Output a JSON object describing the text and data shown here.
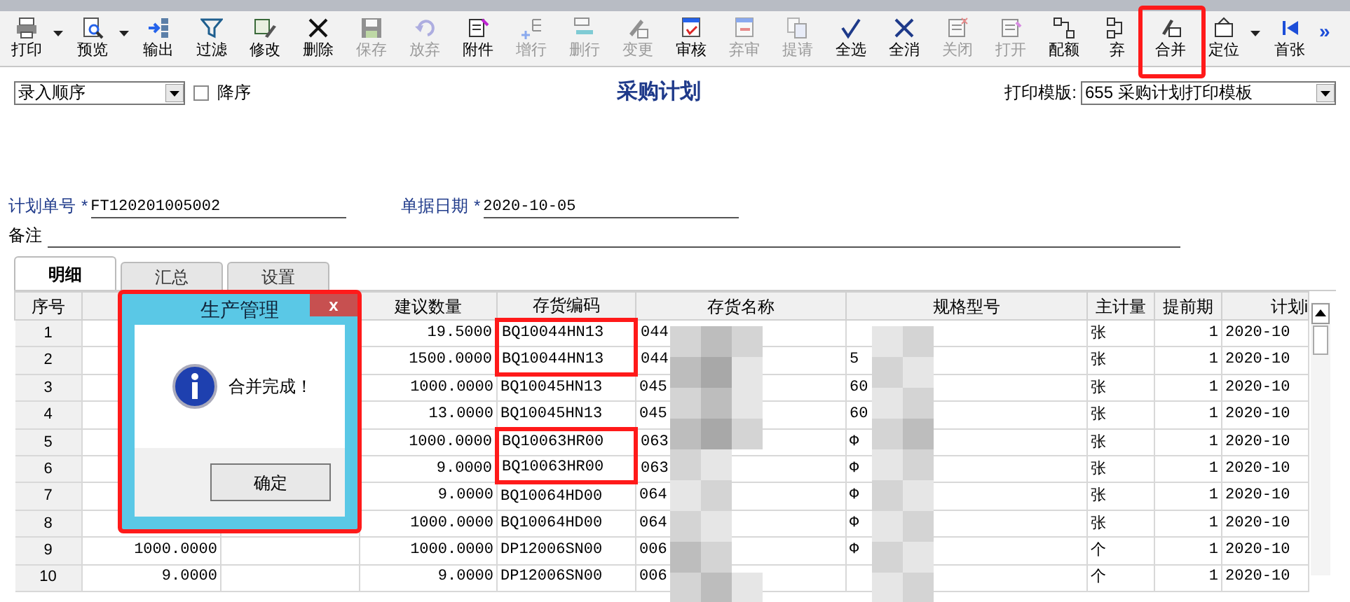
{
  "toolbar": [
    {
      "label": "打印",
      "disabled": false,
      "dropdown": true,
      "highlighted": false
    },
    {
      "label": "预览",
      "disabled": false,
      "dropdown": true,
      "highlighted": false
    },
    {
      "label": "输出",
      "disabled": false,
      "dropdown": false,
      "highlighted": false
    },
    {
      "label": "过滤",
      "disabled": false,
      "dropdown": false,
      "highlighted": false
    },
    {
      "label": "修改",
      "disabled": false,
      "dropdown": false,
      "highlighted": false
    },
    {
      "label": "删除",
      "disabled": false,
      "dropdown": false,
      "highlighted": false
    },
    {
      "label": "保存",
      "disabled": true,
      "dropdown": false,
      "highlighted": false
    },
    {
      "label": "放弃",
      "disabled": true,
      "dropdown": false,
      "highlighted": false
    },
    {
      "label": "附件",
      "disabled": false,
      "dropdown": false,
      "highlighted": false
    },
    {
      "label": "增行",
      "disabled": true,
      "dropdown": false,
      "highlighted": false
    },
    {
      "label": "删行",
      "disabled": true,
      "dropdown": false,
      "highlighted": false
    },
    {
      "label": "变更",
      "disabled": true,
      "dropdown": false,
      "highlighted": false
    },
    {
      "label": "审核",
      "disabled": false,
      "dropdown": false,
      "highlighted": false
    },
    {
      "label": "弃审",
      "disabled": true,
      "dropdown": false,
      "highlighted": false
    },
    {
      "label": "提请",
      "disabled": true,
      "dropdown": false,
      "highlighted": false
    },
    {
      "label": "全选",
      "disabled": false,
      "dropdown": false,
      "highlighted": false
    },
    {
      "label": "全消",
      "disabled": false,
      "dropdown": false,
      "highlighted": false
    },
    {
      "label": "关闭",
      "disabled": true,
      "dropdown": false,
      "highlighted": false
    },
    {
      "label": "打开",
      "disabled": true,
      "dropdown": false,
      "highlighted": false
    },
    {
      "label": "配额",
      "disabled": false,
      "dropdown": false,
      "highlighted": false
    },
    {
      "label": "弃",
      "disabled": false,
      "dropdown": false,
      "highlighted": false
    },
    {
      "label": "合并",
      "disabled": false,
      "dropdown": false,
      "highlighted": true
    },
    {
      "label": "定位",
      "disabled": false,
      "dropdown": true,
      "highlighted": false
    },
    {
      "label": "首张",
      "disabled": false,
      "dropdown": false,
      "highlighted": false
    }
  ],
  "toolbar_more": "»",
  "sort": {
    "value": "录入顺序",
    "descending_label": "降序",
    "descending": false
  },
  "title": "采购计划",
  "print_template": {
    "label": "打印模版:",
    "value": "655 采购计划打印模板"
  },
  "fields": [
    {
      "label": "计划单号",
      "required_mark": "*",
      "value": "FT120201005002"
    },
    {
      "label": "单据日期",
      "required_mark": "*",
      "value": "2020-10-05"
    }
  ],
  "remark": {
    "label": "备注"
  },
  "tabs": [
    {
      "label": "明细",
      "selected": true
    },
    {
      "label": "汇总",
      "selected": false
    },
    {
      "label": "设置",
      "selected": false
    }
  ],
  "table": {
    "columns": [
      "序号",
      "",
      "",
      "建议数量",
      "存货编码",
      "存货名称",
      "规格型号",
      "主计量",
      "提前期",
      "计划i"
    ],
    "rows": [
      {
        "no": "1",
        "column_2": "",
        "qty": "19.5000",
        "code": "BQ10044HN13",
        "name": "044",
        "spec": "",
        "unit": "张",
        "lead": "1",
        "date": "2020-10",
        "code_marked": true
      },
      {
        "no": "2",
        "column_2": "",
        "qty": "1500.0000",
        "code": "BQ10044HN13",
        "name": "044",
        "spec": "5",
        "unit": "张",
        "lead": "1",
        "date": "2020-10",
        "code_marked": true
      },
      {
        "no": "3",
        "column_2": "",
        "qty": "1000.0000",
        "code": "BQ10045HN13",
        "name": "045",
        "spec": "60",
        "unit": "张",
        "lead": "1",
        "date": "2020-10",
        "code_marked": false
      },
      {
        "no": "4",
        "column_2": "",
        "qty": "13.0000",
        "code": "BQ10045HN13",
        "name": "045",
        "spec": "60",
        "unit": "张",
        "lead": "1",
        "date": "2020-10",
        "code_marked": false
      },
      {
        "no": "5",
        "column_2": "",
        "qty": "1000.0000",
        "code": "BQ10063HR00",
        "name": "063",
        "spec": "Φ",
        "unit": "张",
        "lead": "1",
        "date": "2020-10",
        "code_marked": true
      },
      {
        "no": "6",
        "column_2": "",
        "qty": "9.0000",
        "code": "BQ10063HR00",
        "name": "063",
        "spec": "Φ",
        "unit": "张",
        "lead": "1",
        "date": "2020-10",
        "code_marked": true
      },
      {
        "no": "7",
        "column_2": "",
        "qty": "9.0000",
        "code": "BQ10064HD00",
        "name": "064",
        "spec": "Φ",
        "unit": "张",
        "lead": "1",
        "date": "2020-10",
        "code_marked": false
      },
      {
        "no": "8",
        "column_2": "",
        "qty": "1000.0000",
        "code": "BQ10064HD00",
        "name": "064",
        "spec": "Φ",
        "unit": "张",
        "lead": "1",
        "date": "2020-10",
        "code_marked": false
      },
      {
        "no": "9",
        "column_2": "1000.0000",
        "qty": "1000.0000",
        "code": "DP12006SN00",
        "name": "006",
        "spec": "Φ",
        "unit": "个",
        "lead": "1",
        "date": "2020-10",
        "code_marked": false
      },
      {
        "no": "10",
        "column_2": "9.0000",
        "qty": "9.0000",
        "code": "DP12006SN00",
        "name": "006",
        "spec": "",
        "unit": "个",
        "lead": "1",
        "date": "2020-10",
        "code_marked": false
      }
    ]
  },
  "dialog": {
    "title": "生产管理",
    "close": "x",
    "message": "合并完成！",
    "button": "确定",
    "highlighted": true
  }
}
